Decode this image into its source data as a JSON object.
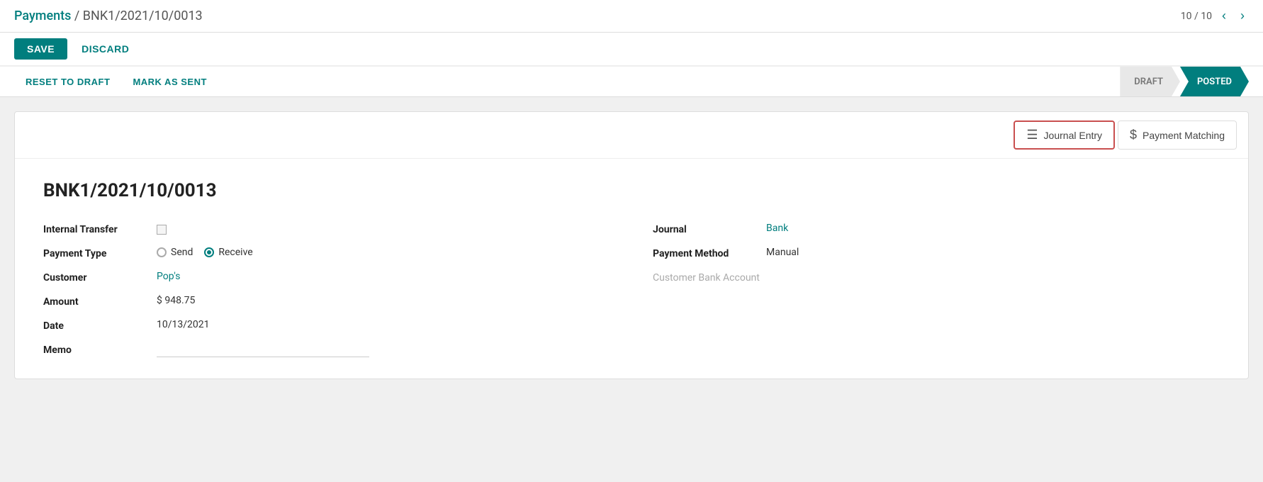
{
  "breadcrumb": {
    "parent_label": "Payments",
    "separator": " / ",
    "current": "BNK1/2021/10/0013"
  },
  "toolbar": {
    "save_label": "SAVE",
    "discard_label": "DISCARD",
    "pagination": "10 / 10"
  },
  "status_bar": {
    "reset_to_draft_label": "RESET TO DRAFT",
    "mark_as_sent_label": "MARK AS SENT",
    "steps": [
      {
        "key": "draft",
        "label": "DRAFT"
      },
      {
        "key": "posted",
        "label": "POSTED"
      }
    ],
    "active_step": "posted"
  },
  "smart_buttons": [
    {
      "key": "journal-entry",
      "icon": "≡",
      "label": "Journal Entry",
      "active": true
    },
    {
      "key": "payment-matching",
      "icon": "$",
      "label": "Payment Matching",
      "active": false
    }
  ],
  "form": {
    "record_id": "BNK1/2021/10/0013",
    "left_fields": [
      {
        "key": "internal-transfer",
        "label": "Internal Transfer",
        "type": "checkbox",
        "value": false
      },
      {
        "key": "payment-type",
        "label": "Payment Type",
        "type": "radio",
        "options": [
          "Send",
          "Receive"
        ],
        "selected": "Receive"
      },
      {
        "key": "customer",
        "label": "Customer",
        "type": "link",
        "value": "Pop's"
      },
      {
        "key": "amount",
        "label": "Amount",
        "type": "text",
        "value": "$ 948.75"
      },
      {
        "key": "date",
        "label": "Date",
        "type": "text",
        "value": "10/13/2021"
      },
      {
        "key": "memo",
        "label": "Memo",
        "type": "text",
        "value": ""
      }
    ],
    "right_fields": [
      {
        "key": "journal",
        "label": "Journal",
        "type": "link",
        "value": "Bank"
      },
      {
        "key": "payment-method",
        "label": "Payment Method",
        "type": "text",
        "value": "Manual"
      },
      {
        "key": "customer-bank-account",
        "label": "Customer Bank Account",
        "type": "muted",
        "value": ""
      }
    ]
  }
}
